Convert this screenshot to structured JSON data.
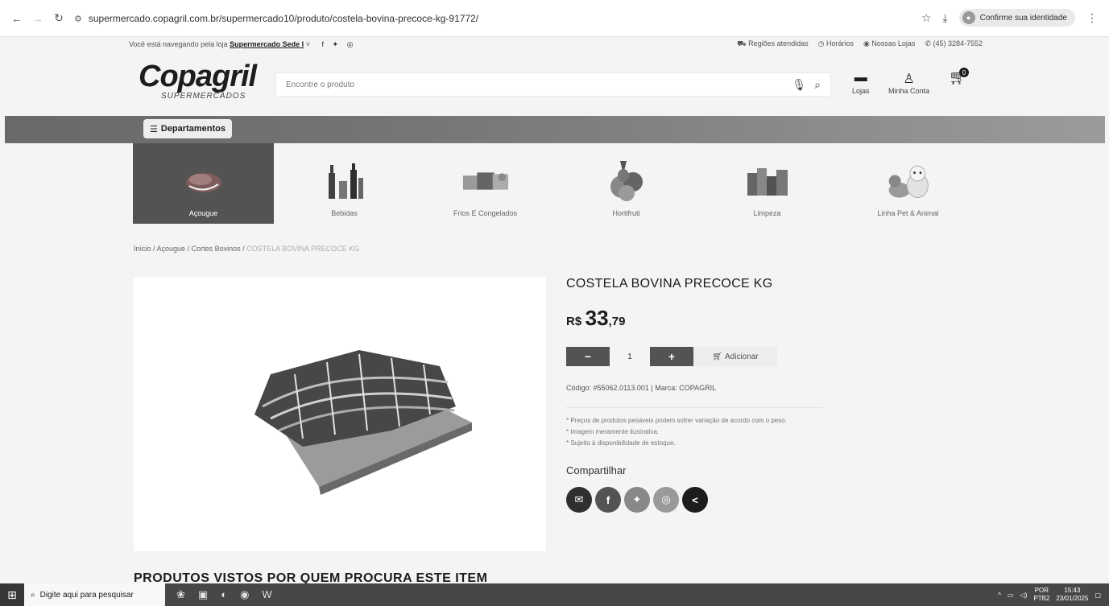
{
  "browser": {
    "url": "supermercado.copagril.com.br/supermercado10/produto/costela-bovina-precoce-kg-91772/",
    "identity_label": "Confirme sua identidade"
  },
  "topbar": {
    "browsing_text": "Você está navegando pela loja",
    "store_name": "Supermercado Sede I",
    "regions": "Regiões atendidas",
    "hours": "Horários",
    "stores": "Nossas Lojas",
    "phone": "(45) 3284-7552"
  },
  "header": {
    "logo_brand": "Copagril",
    "logo_sub": "SUPERMERCADOS",
    "search_placeholder": "Encontre o produto",
    "stores_label": "Lojas",
    "account_label": "Minha Conta",
    "cart_count": "0"
  },
  "departments": {
    "button_label": "Departamentos",
    "categories": [
      {
        "label": "Açougue",
        "active": true
      },
      {
        "label": "Bebidas",
        "active": false
      },
      {
        "label": "Frios E Congelados",
        "active": false
      },
      {
        "label": "Hortifruti",
        "active": false
      },
      {
        "label": "Limpeza",
        "active": false
      },
      {
        "label": "Linha Pet & Animal",
        "active": false
      }
    ]
  },
  "breadcrumb": {
    "home": "Início",
    "level1": "Açougue",
    "level2": "Cortes Bovinos",
    "current": "COSTELA BOVINA PRECOCE KG"
  },
  "product": {
    "title": "COSTELA BOVINA PRECOCE KG",
    "currency": "R$",
    "price_int": "33",
    "price_dec": ",79",
    "quantity": "1",
    "add_label": "Adicionar",
    "code_line": "Código: #55062.0113.001 | Marca: COPAGRIL",
    "notes": [
      "* Preços de produtos pesáveis podem sofrer variação de acordo com o peso.",
      "* Imagem meramente ilustrativa.",
      "* Sujeito à disponibilidade de estoque."
    ],
    "share_label": "Compartilhar"
  },
  "related": {
    "heading": "PRODUTOS VISTOS POR QUEM PROCURA ESTE ITEM"
  },
  "taskbar": {
    "search_placeholder": "Digite aqui para pesquisar",
    "lang_top": "POR",
    "lang_bottom": "PTB2",
    "time": "15:43",
    "date": "23/01/2025"
  }
}
